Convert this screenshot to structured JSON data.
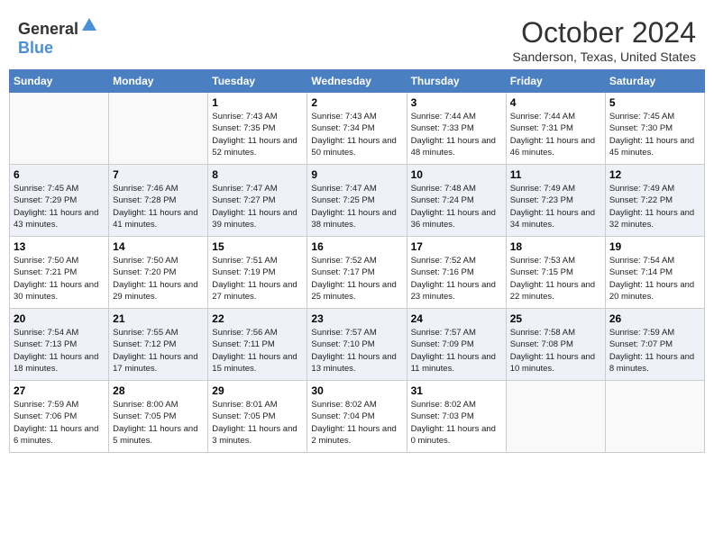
{
  "header": {
    "logo_general": "General",
    "logo_blue": "Blue",
    "month": "October 2024",
    "location": "Sanderson, Texas, United States"
  },
  "weekdays": [
    "Sunday",
    "Monday",
    "Tuesday",
    "Wednesday",
    "Thursday",
    "Friday",
    "Saturday"
  ],
  "weeks": [
    [
      {
        "day": "",
        "info": ""
      },
      {
        "day": "",
        "info": ""
      },
      {
        "day": "1",
        "info": "Sunrise: 7:43 AM\nSunset: 7:35 PM\nDaylight: 11 hours and 52 minutes."
      },
      {
        "day": "2",
        "info": "Sunrise: 7:43 AM\nSunset: 7:34 PM\nDaylight: 11 hours and 50 minutes."
      },
      {
        "day": "3",
        "info": "Sunrise: 7:44 AM\nSunset: 7:33 PM\nDaylight: 11 hours and 48 minutes."
      },
      {
        "day": "4",
        "info": "Sunrise: 7:44 AM\nSunset: 7:31 PM\nDaylight: 11 hours and 46 minutes."
      },
      {
        "day": "5",
        "info": "Sunrise: 7:45 AM\nSunset: 7:30 PM\nDaylight: 11 hours and 45 minutes."
      }
    ],
    [
      {
        "day": "6",
        "info": "Sunrise: 7:45 AM\nSunset: 7:29 PM\nDaylight: 11 hours and 43 minutes."
      },
      {
        "day": "7",
        "info": "Sunrise: 7:46 AM\nSunset: 7:28 PM\nDaylight: 11 hours and 41 minutes."
      },
      {
        "day": "8",
        "info": "Sunrise: 7:47 AM\nSunset: 7:27 PM\nDaylight: 11 hours and 39 minutes."
      },
      {
        "day": "9",
        "info": "Sunrise: 7:47 AM\nSunset: 7:25 PM\nDaylight: 11 hours and 38 minutes."
      },
      {
        "day": "10",
        "info": "Sunrise: 7:48 AM\nSunset: 7:24 PM\nDaylight: 11 hours and 36 minutes."
      },
      {
        "day": "11",
        "info": "Sunrise: 7:49 AM\nSunset: 7:23 PM\nDaylight: 11 hours and 34 minutes."
      },
      {
        "day": "12",
        "info": "Sunrise: 7:49 AM\nSunset: 7:22 PM\nDaylight: 11 hours and 32 minutes."
      }
    ],
    [
      {
        "day": "13",
        "info": "Sunrise: 7:50 AM\nSunset: 7:21 PM\nDaylight: 11 hours and 30 minutes."
      },
      {
        "day": "14",
        "info": "Sunrise: 7:50 AM\nSunset: 7:20 PM\nDaylight: 11 hours and 29 minutes."
      },
      {
        "day": "15",
        "info": "Sunrise: 7:51 AM\nSunset: 7:19 PM\nDaylight: 11 hours and 27 minutes."
      },
      {
        "day": "16",
        "info": "Sunrise: 7:52 AM\nSunset: 7:17 PM\nDaylight: 11 hours and 25 minutes."
      },
      {
        "day": "17",
        "info": "Sunrise: 7:52 AM\nSunset: 7:16 PM\nDaylight: 11 hours and 23 minutes."
      },
      {
        "day": "18",
        "info": "Sunrise: 7:53 AM\nSunset: 7:15 PM\nDaylight: 11 hours and 22 minutes."
      },
      {
        "day": "19",
        "info": "Sunrise: 7:54 AM\nSunset: 7:14 PM\nDaylight: 11 hours and 20 minutes."
      }
    ],
    [
      {
        "day": "20",
        "info": "Sunrise: 7:54 AM\nSunset: 7:13 PM\nDaylight: 11 hours and 18 minutes."
      },
      {
        "day": "21",
        "info": "Sunrise: 7:55 AM\nSunset: 7:12 PM\nDaylight: 11 hours and 17 minutes."
      },
      {
        "day": "22",
        "info": "Sunrise: 7:56 AM\nSunset: 7:11 PM\nDaylight: 11 hours and 15 minutes."
      },
      {
        "day": "23",
        "info": "Sunrise: 7:57 AM\nSunset: 7:10 PM\nDaylight: 11 hours and 13 minutes."
      },
      {
        "day": "24",
        "info": "Sunrise: 7:57 AM\nSunset: 7:09 PM\nDaylight: 11 hours and 11 minutes."
      },
      {
        "day": "25",
        "info": "Sunrise: 7:58 AM\nSunset: 7:08 PM\nDaylight: 11 hours and 10 minutes."
      },
      {
        "day": "26",
        "info": "Sunrise: 7:59 AM\nSunset: 7:07 PM\nDaylight: 11 hours and 8 minutes."
      }
    ],
    [
      {
        "day": "27",
        "info": "Sunrise: 7:59 AM\nSunset: 7:06 PM\nDaylight: 11 hours and 6 minutes."
      },
      {
        "day": "28",
        "info": "Sunrise: 8:00 AM\nSunset: 7:05 PM\nDaylight: 11 hours and 5 minutes."
      },
      {
        "day": "29",
        "info": "Sunrise: 8:01 AM\nSunset: 7:05 PM\nDaylight: 11 hours and 3 minutes."
      },
      {
        "day": "30",
        "info": "Sunrise: 8:02 AM\nSunset: 7:04 PM\nDaylight: 11 hours and 2 minutes."
      },
      {
        "day": "31",
        "info": "Sunrise: 8:02 AM\nSunset: 7:03 PM\nDaylight: 11 hours and 0 minutes."
      },
      {
        "day": "",
        "info": ""
      },
      {
        "day": "",
        "info": ""
      }
    ]
  ]
}
